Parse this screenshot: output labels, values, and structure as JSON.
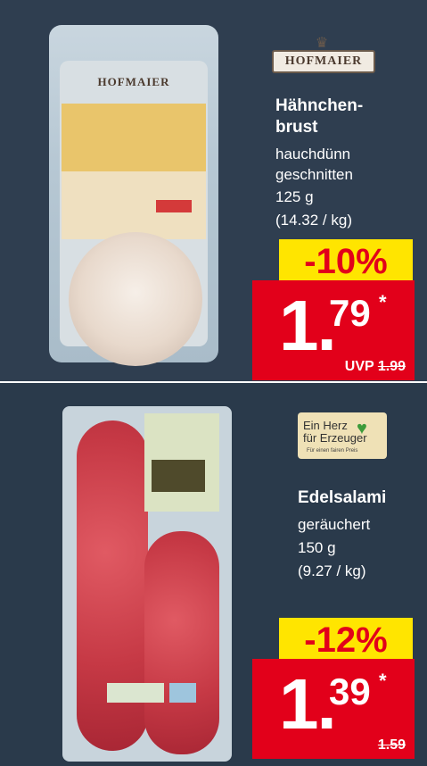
{
  "products": [
    {
      "brand": "HOFMAIER",
      "name_line1": "Hähnchen-",
      "name_line2": "brust",
      "desc_line1": "hauchdünn",
      "desc_line2": "geschnitten",
      "weight": "125 g",
      "unit_price": "(14.32 / kg)",
      "discount": "-10%",
      "price_euros": "1.",
      "price_cents": "79",
      "price_star": "*",
      "uvp_label": "UVP",
      "old_price": "1.99"
    },
    {
      "logo_line1": "Ein Herz",
      "logo_line2": "für Erzeuger",
      "logo_line3": "Für einen fairen Preis",
      "name_line1": "Edelsalami",
      "desc_line1": "geräuchert",
      "weight": "150 g",
      "unit_price": "(9.27 / kg)",
      "discount": "-12%",
      "price_euros": "1.",
      "price_cents": "39",
      "price_star": "*",
      "old_price": "1.59"
    }
  ],
  "colors": {
    "panel": "#2f3e50",
    "price_red": "#e2001a",
    "discount_yellow": "#ffe500"
  },
  "icons": [
    "crown-icon",
    "heart-icon"
  ]
}
